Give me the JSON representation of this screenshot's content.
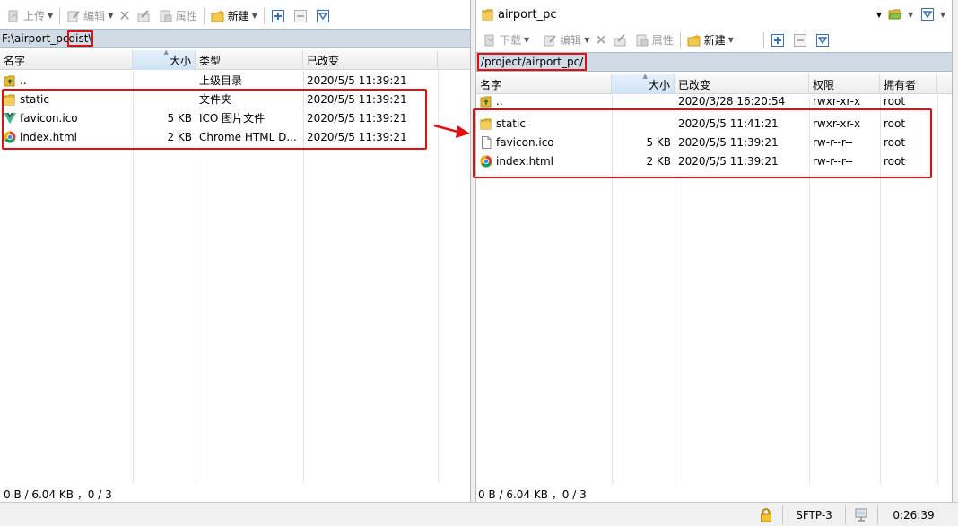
{
  "left": {
    "toolbar": {
      "upload_label": "上传",
      "edit_label": "编辑",
      "properties_label": "属性",
      "new_label": "新建"
    },
    "path": {
      "prefix": "F:\\airport_pc",
      "highlight": "dist\\"
    },
    "columns": [
      "名字",
      "大小",
      "类型",
      "已改变"
    ],
    "rows": [
      {
        "name": "..",
        "size": "",
        "type": "上级目录",
        "changed": "2020/5/5  11:39:21",
        "icon": "up-folder-icon"
      },
      {
        "name": "static",
        "size": "",
        "type": "文件夹",
        "changed": "2020/5/5  11:39:21",
        "icon": "folder-icon"
      },
      {
        "name": "favicon.ico",
        "size": "5 KB",
        "type": "ICO 图片文件",
        "changed": "2020/5/5  11:39:21",
        "icon": "vue-logo-icon"
      },
      {
        "name": "index.html",
        "size": "2 KB",
        "type": "Chrome HTML D...",
        "changed": "2020/5/5  11:39:21",
        "icon": "chrome-icon"
      }
    ],
    "status": "0 B / 6.04 KB ，0 / 3"
  },
  "right": {
    "location_combo": "airport_pc",
    "toolbar": {
      "download_label": "下载",
      "edit_label": "编辑",
      "properties_label": "属性",
      "new_label": "新建"
    },
    "path": "/project/airport_pc/",
    "columns": [
      "名字",
      "大小",
      "已改变",
      "权限",
      "拥有者"
    ],
    "rows": [
      {
        "name": "..",
        "size": "",
        "changed": "2020/3/28 16:20:54",
        "rights": "rwxr-xr-x",
        "owner": "root",
        "icon": "up-folder-icon"
      },
      {
        "name": "static",
        "size": "",
        "changed": "2020/5/5 11:41:21",
        "rights": "rwxr-xr-x",
        "owner": "root",
        "icon": "folder-icon"
      },
      {
        "name": "favicon.ico",
        "size": "5 KB",
        "changed": "2020/5/5 11:39:21",
        "rights": "rw-r--r--",
        "owner": "root",
        "icon": "file-icon"
      },
      {
        "name": "index.html",
        "size": "2 KB",
        "changed": "2020/5/5 11:39:21",
        "rights": "rw-r--r--",
        "owner": "root",
        "icon": "chrome-icon"
      }
    ],
    "status": "0 B / 6.04 KB ，0 / 3"
  },
  "bottom": {
    "protocol": "SFTP-3",
    "elapsed": "0:26:39"
  },
  "colors": {
    "highlight_red": "#e01010",
    "path_bar": "#d0dbe5",
    "folder_yellow": "#e8b93a"
  }
}
